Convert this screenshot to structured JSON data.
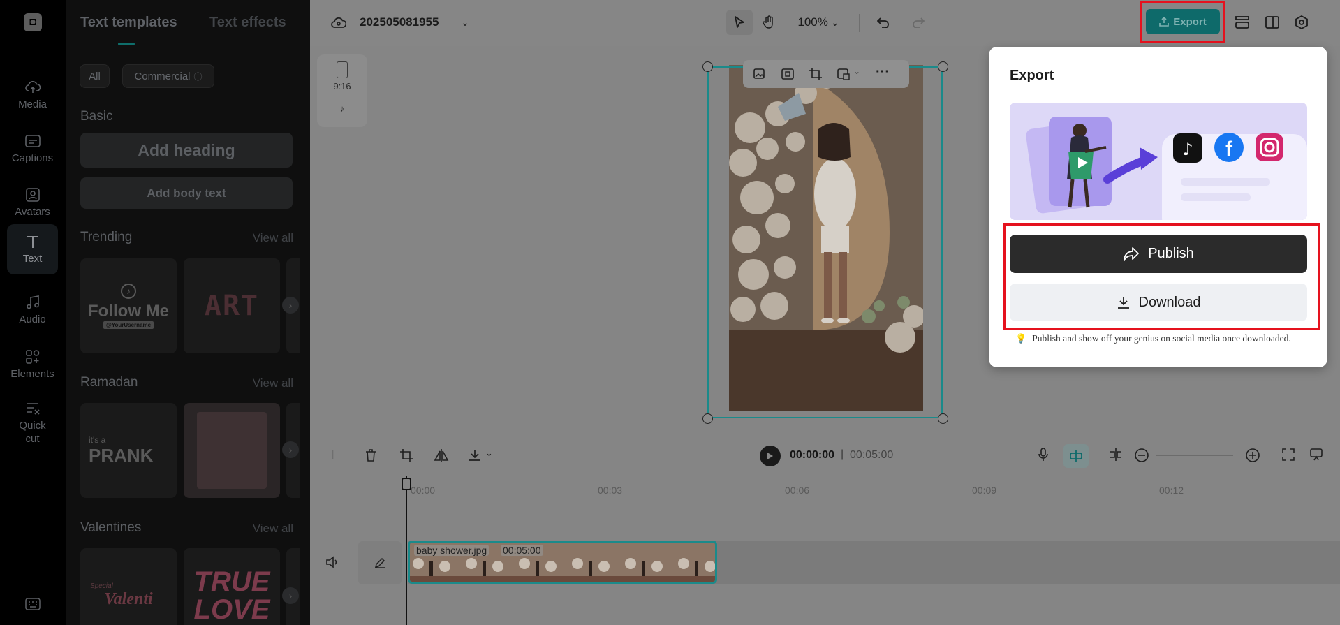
{
  "rail": {
    "items": [
      {
        "label": "Media",
        "icon": "cloud-upload-icon"
      },
      {
        "label": "Captions",
        "icon": "captions-icon"
      },
      {
        "label": "Avatars",
        "icon": "avatar-icon"
      },
      {
        "label": "Text",
        "icon": "text-icon"
      },
      {
        "label": "Audio",
        "icon": "music-note-icon"
      },
      {
        "label": "Elements",
        "icon": "elements-icon"
      },
      {
        "label": "Quick cut",
        "icon": "quick-cut-icon"
      }
    ],
    "active": "Text"
  },
  "panel": {
    "tabs": [
      "Text templates",
      "Text effects"
    ],
    "filters": {
      "all": "All",
      "commercial": "Commercial"
    },
    "basic": {
      "title": "Basic",
      "heading_btn": "Add heading",
      "body_btn": "Add body text"
    },
    "view_all": "View all",
    "sections": [
      {
        "title": "Trending",
        "cards": [
          {
            "text": "Follow Me",
            "sub": "@YourUsername"
          },
          {
            "text": "ART"
          }
        ]
      },
      {
        "title": "Ramadan",
        "cards": [
          {
            "text": "PRANK",
            "small": "it's a"
          },
          {
            "text": ""
          }
        ]
      },
      {
        "title": "Valentines",
        "cards": [
          {
            "text": "Valenti",
            "small": "Special"
          },
          {
            "text": "TRUE LOVE"
          }
        ]
      }
    ]
  },
  "topbar": {
    "project_name": "202505081955",
    "zoom": "100%",
    "export_label": "Export"
  },
  "ratio": {
    "label": "9:16"
  },
  "timeline": {
    "time_current": "00:00:00",
    "time_total": "00:05:00",
    "ruler": [
      "00:00",
      "00:03",
      "00:06",
      "00:09",
      "00:12"
    ],
    "clip": {
      "name": "baby shower.jpg",
      "duration": "00:05:00"
    }
  },
  "export_popup": {
    "title": "Export",
    "publish": "Publish",
    "download": "Download",
    "hint": "Publish and show off your genius on social media once downloaded."
  },
  "colors": {
    "accent": "#0e6a6a",
    "highlight": "#e5121e",
    "publish_bg": "#2b2b2b"
  }
}
